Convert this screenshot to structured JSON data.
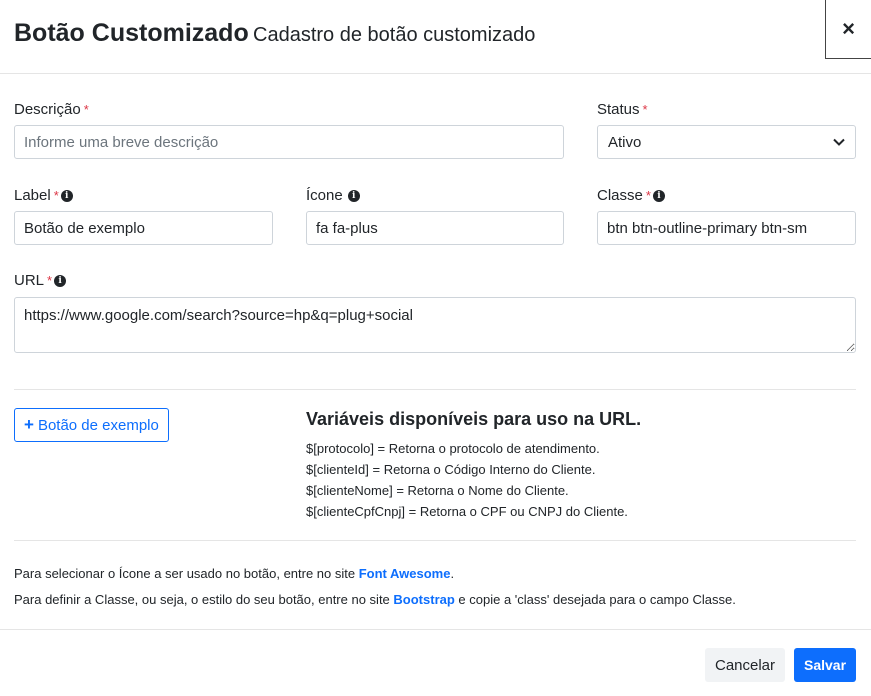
{
  "header": {
    "title": "Botão Customizado",
    "subtitle": "Cadastro de botão customizado",
    "close_glyph": "×"
  },
  "form": {
    "descricao": {
      "label": "Descrição",
      "required_mark": "*",
      "value": "",
      "placeholder": "Informe uma breve descrição"
    },
    "status": {
      "label": "Status",
      "required_mark": "*",
      "selected": "Ativo"
    },
    "label": {
      "label": "Label",
      "required_mark": "*",
      "value": "Botão de exemplo"
    },
    "icone": {
      "label": "Ícone",
      "value": "fa fa-plus"
    },
    "classe": {
      "label": "Classe",
      "required_mark": "*",
      "value": "btn btn-outline-primary btn-sm"
    },
    "url": {
      "label": "URL",
      "required_mark": "*",
      "value": "https://www.google.com/search?source=hp&q=plug+social"
    }
  },
  "preview": {
    "button_label": "Botão de exemplo",
    "button_icon": "plus-icon"
  },
  "variables": {
    "title": "Variáveis disponíveis para uso na URL.",
    "lines": [
      "$[protocolo] = Retorna o protocolo de atendimento.",
      "$[clienteId] = Retorna o Código Interno do Cliente.",
      "$[clienteNome] = Retorna o Nome do Cliente.",
      "$[clienteCpfCnpj] = Retorna o CPF ou CNPJ do Cliente."
    ]
  },
  "help": {
    "line1_prefix": "Para selecionar o Ícone a ser usado no botão, entre no site ",
    "line1_link": "Font Awesome",
    "line1_suffix": ".",
    "line2_prefix": "Para definir a Classe, ou seja, o estilo do seu botão, entre no site ",
    "line2_link": "Bootstrap",
    "line2_suffix": " e copie a 'class' desejada para o campo Classe."
  },
  "footer": {
    "cancel_label": "Cancelar",
    "save_label": "Salvar"
  },
  "colors": {
    "primary": "#0d6efd",
    "required": "#dc3545"
  }
}
